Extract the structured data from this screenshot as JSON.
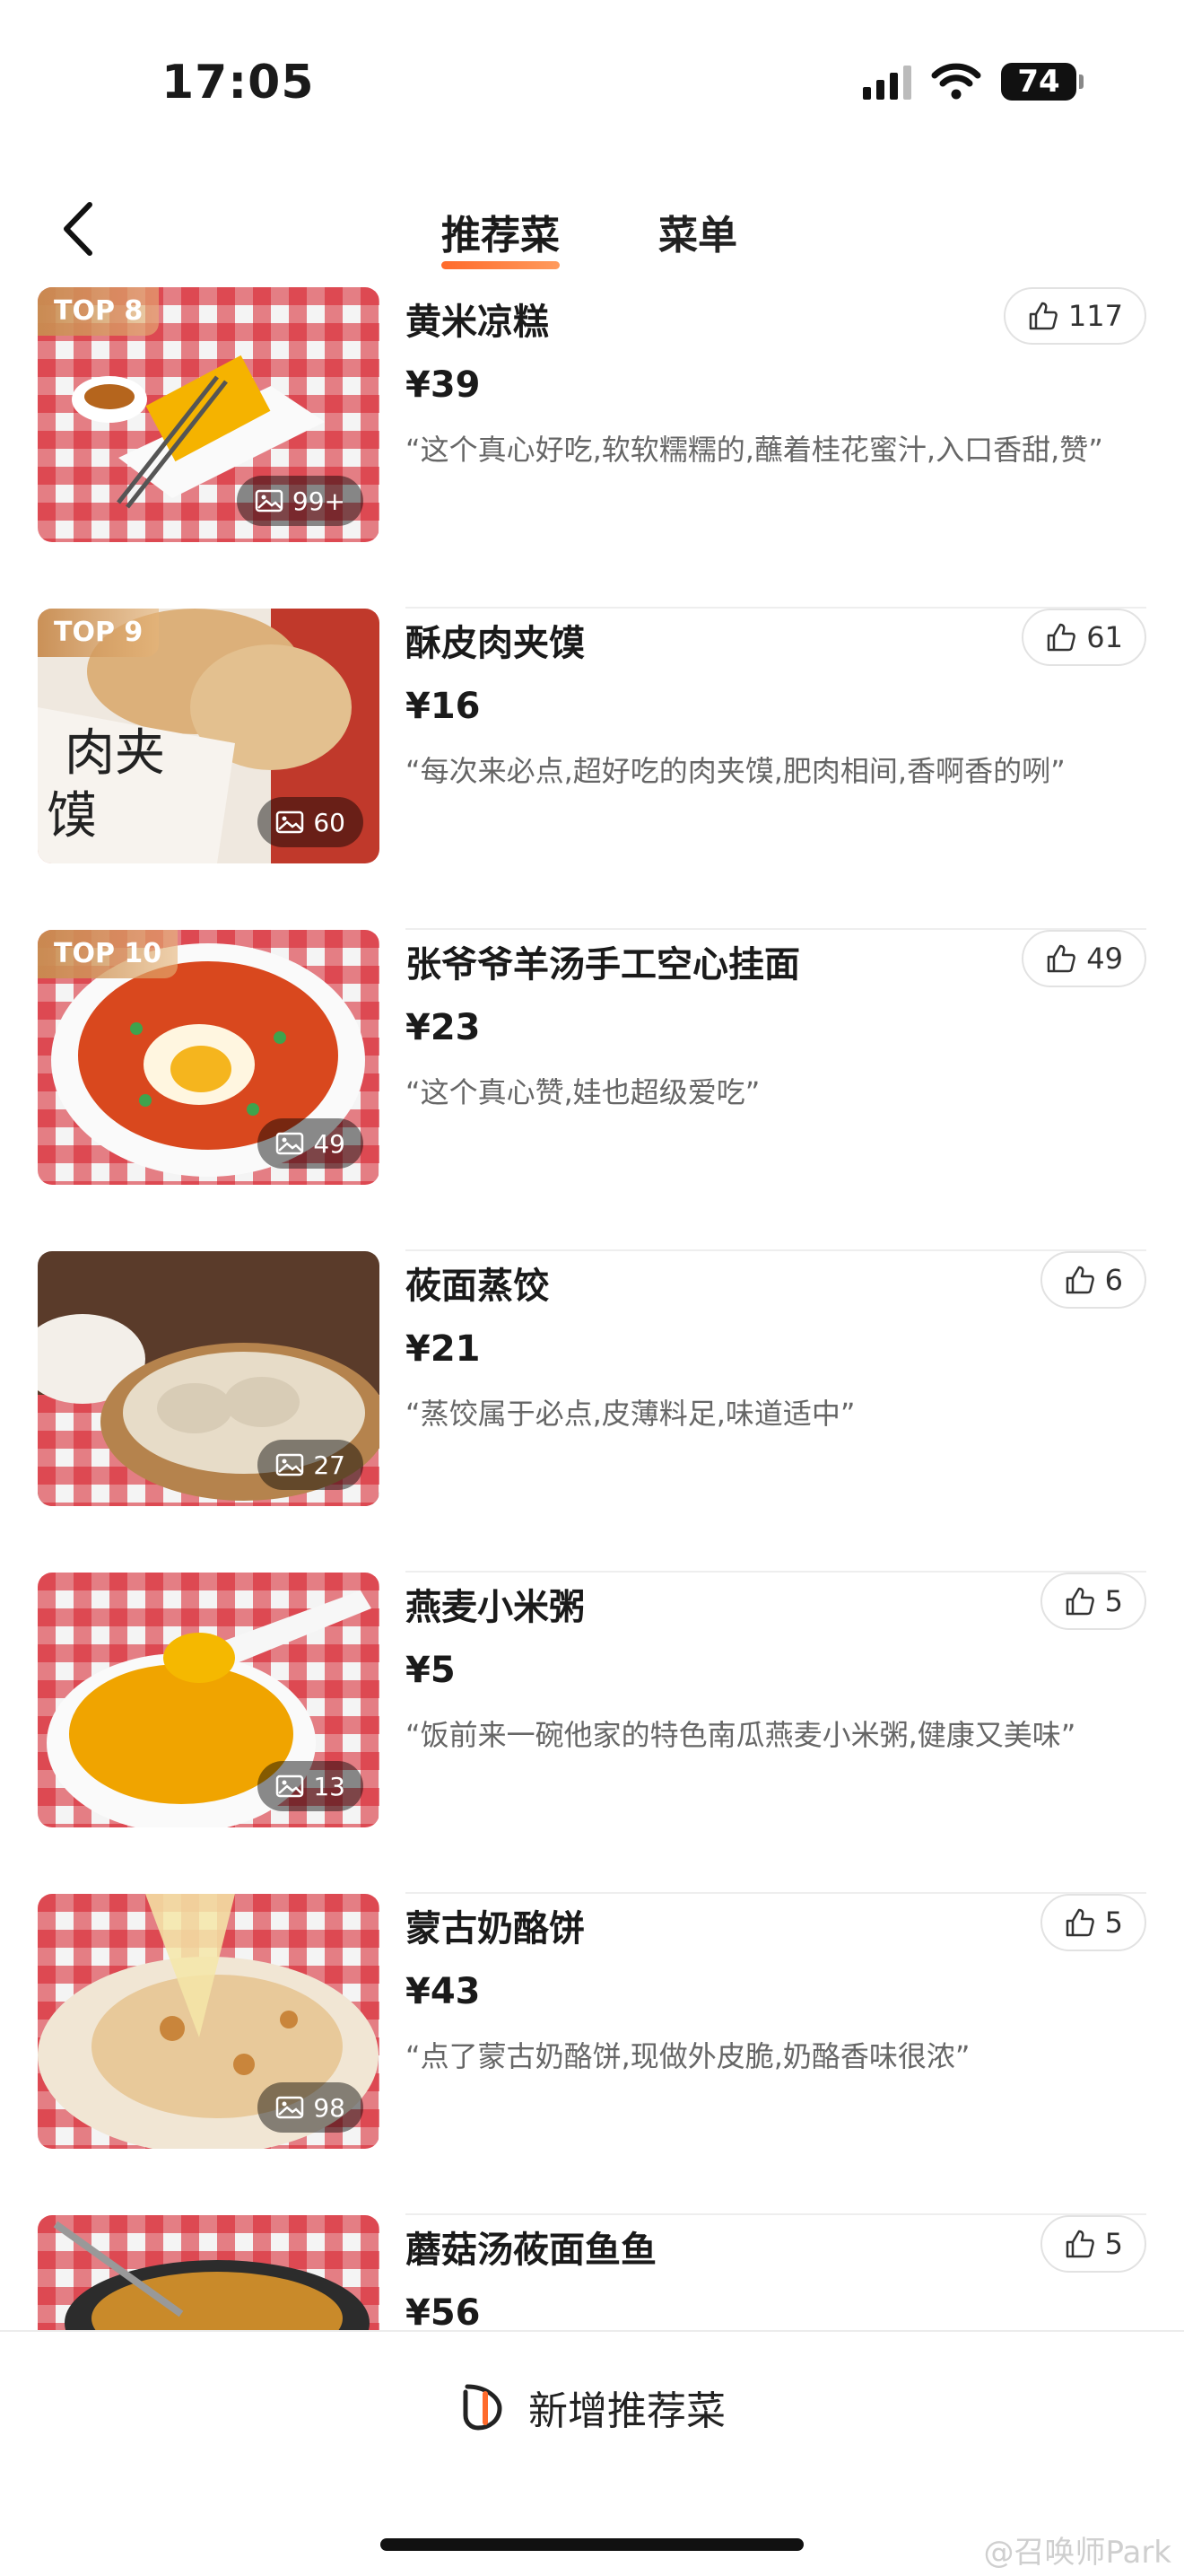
{
  "status_bar": {
    "time": "17:05",
    "battery": "74"
  },
  "nav": {
    "tab_recommended": "推荐菜",
    "tab_menu": "菜单"
  },
  "dishes": [
    {
      "top": "TOP 8",
      "name": "黄米凉糕",
      "price": "¥39",
      "quote": "“这个真心好吃,软软糯糯的,蘸着桂花蜜汁,入口香甜,赞”",
      "likes": "117",
      "images": "99+"
    },
    {
      "top": "TOP 9",
      "name": "酥皮肉夹馍",
      "price": "¥16",
      "quote": "“每次来必点,超好吃的肉夹馍,肥肉相间,香啊香的咧”",
      "likes": "61",
      "images": "60"
    },
    {
      "top": "TOP 10",
      "name": "张爷爷羊汤手工空心挂面",
      "price": "¥23",
      "quote": "“这个真心赞,娃也超级爱吃”",
      "likes": "49",
      "images": "49"
    },
    {
      "top": "",
      "name": "莜面蒸饺",
      "price": "¥21",
      "quote": "“蒸饺属于必点,皮薄料足,味道适中”",
      "likes": "6",
      "images": "27"
    },
    {
      "top": "",
      "name": "燕麦小米粥",
      "price": "¥5",
      "quote": "“饭前来一碗他家的特色南瓜燕麦小米粥,健康又美味”",
      "likes": "5",
      "images": "13"
    },
    {
      "top": "",
      "name": "蒙古奶酪饼",
      "price": "¥43",
      "quote": "“点了蒙古奶酪饼,现做外皮脆,奶酪香味很浓”",
      "likes": "5",
      "images": "98"
    },
    {
      "top": "",
      "name": "蘑菇汤莜面鱼鱼",
      "price": "¥56",
      "quote": "",
      "likes": "5",
      "images": ""
    }
  ],
  "bottom": {
    "add_label": "新增推荐菜",
    "watermark": "@召唤师Park"
  },
  "colors": {
    "accent": "#ff6a2b",
    "text": "#1a1a1a",
    "quote": "#666666"
  }
}
